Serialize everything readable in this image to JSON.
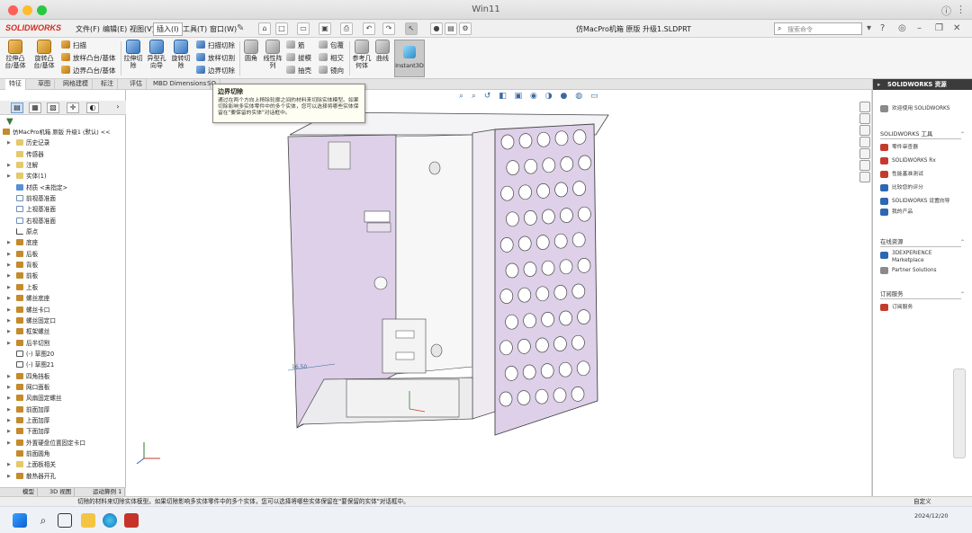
{
  "window": {
    "title": "Win11"
  },
  "menubar": {
    "logo": "SOLIDWORKS",
    "menus": [
      "文件(F)",
      "编辑(E)",
      "视图(V)",
      "插入(I)",
      "工具(T)",
      "窗口(W)"
    ],
    "active_menu_index": 3,
    "doc_title": "仿MacPro机箱 原版 升级1.SLDPRT",
    "search_placeholder": "搜索命令"
  },
  "commands": {
    "big": [
      {
        "label": "拉伸凸台/基体"
      },
      {
        "label": "旋转凸台/基体"
      },
      {
        "label": "拉伸切除"
      },
      {
        "label": "异型孔向导"
      },
      {
        "label": "旋转切除"
      },
      {
        "label": "圆角"
      },
      {
        "label": "线性阵列"
      },
      {
        "label": "参考几何体"
      },
      {
        "label": "曲线"
      },
      {
        "label": "Instant3D"
      }
    ],
    "small": {
      "sweep": "扫描",
      "loft": "放样凸台/基体",
      "boundary": "边界凸台/基体",
      "sweep_cut": "扫描切除",
      "loft_cut": "放样切割",
      "boundary_cut": "边界切除",
      "rib": "筋",
      "wrap": "包覆",
      "draft": "拔模",
      "intersect": "相交",
      "shell": "抽壳",
      "mirror": "镜向"
    }
  },
  "command_tabs": [
    "特征",
    "草图",
    "网格建模",
    "标注",
    "评估",
    "MBD Dimensions",
    "SO"
  ],
  "tooltip": {
    "title": "边界切除",
    "body": "通过在两个方向上移除轮廓之间的材料来切除实体模型。如果切除影响多实体零件中的多个实体，您可以选择将哪些实体保留在\"要保留的实体\"对话框中。"
  },
  "tree": {
    "root": "仿MacPro机箱 原版 升级1 (默认) <<",
    "items": [
      {
        "label": "历史记录",
        "arrow": true,
        "icon": "folder"
      },
      {
        "label": "传感器",
        "arrow": false,
        "icon": "folder"
      },
      {
        "label": "注解",
        "arrow": true,
        "icon": "folder"
      },
      {
        "label": "实体(1)",
        "arrow": true,
        "icon": "folder"
      },
      {
        "label": "材质 <未指定>",
        "arrow": false,
        "icon": "blue"
      },
      {
        "label": "前视基准面",
        "arrow": false,
        "icon": "plane"
      },
      {
        "label": "上视基准面",
        "arrow": false,
        "icon": "plane"
      },
      {
        "label": "右视基准面",
        "arrow": false,
        "icon": "plane"
      },
      {
        "label": "原点",
        "arrow": false,
        "icon": "origin"
      },
      {
        "label": "底座",
        "arrow": true,
        "icon": "feature"
      },
      {
        "label": "后板",
        "arrow": true,
        "icon": "feature"
      },
      {
        "label": "背板",
        "arrow": true,
        "icon": "feature"
      },
      {
        "label": "前板",
        "arrow": true,
        "icon": "feature"
      },
      {
        "label": "上板",
        "arrow": true,
        "icon": "feature"
      },
      {
        "label": "螺丝底座",
        "arrow": true,
        "icon": "feature"
      },
      {
        "label": "螺丝卡口",
        "arrow": true,
        "icon": "feature"
      },
      {
        "label": "螺丝固定口",
        "arrow": true,
        "icon": "feature"
      },
      {
        "label": "框架螺丝",
        "arrow": true,
        "icon": "feature"
      },
      {
        "label": "后半切割",
        "arrow": true,
        "icon": "feature"
      },
      {
        "label": "(-) 草图20",
        "arrow": false,
        "icon": "sketch"
      },
      {
        "label": "(-) 草图21",
        "arrow": false,
        "icon": "sketch"
      },
      {
        "label": "四角挡板",
        "arrow": true,
        "icon": "feature"
      },
      {
        "label": "网口面板",
        "arrow": true,
        "icon": "feature"
      },
      {
        "label": "风扇固定螺丝",
        "arrow": true,
        "icon": "feature"
      },
      {
        "label": "前面加厚",
        "arrow": true,
        "icon": "feature"
      },
      {
        "label": "上面加厚",
        "arrow": true,
        "icon": "feature"
      },
      {
        "label": "下面加厚",
        "arrow": true,
        "icon": "feature"
      },
      {
        "label": "外置硬盘位置固定卡口",
        "arrow": true,
        "icon": "feature"
      },
      {
        "label": "前面圆角",
        "arrow": false,
        "icon": "feature"
      },
      {
        "label": "上面板相关",
        "arrow": true,
        "icon": "folder"
      },
      {
        "label": "散热器开孔",
        "arrow": true,
        "icon": "feature"
      }
    ]
  },
  "bottom_tabs": [
    "模型",
    "3D 视图",
    "运动算例 1"
  ],
  "viewport": {
    "dimension_label": "16.50"
  },
  "resources": {
    "header": "SOLIDWORKS 资源",
    "welcome": "欢迎使用 SOLIDWORKS",
    "tools_title": "SOLIDWORKS 工具",
    "tools": [
      "零件审查器",
      "SOLIDWORKS Rx",
      "性能基准测试",
      "比较您的评分",
      "SOLIDWORKS 设置向导",
      "我的产品"
    ],
    "community_title": "在线资源",
    "community": [
      "3DEXPERIENCE Marketplace",
      "Partner Solutions"
    ],
    "subscription_title": "订阅服务",
    "subscription": [
      "订阅服务"
    ]
  },
  "statusbar": {
    "text": "切除的材料来切除实体模型。如果切除影响多实体零件中的多个实体，您可以选择将哪些实体保留在\"要保留的实体\"对话框中。",
    "right": "自定义"
  },
  "taskbar": {
    "date": "2024/12/20"
  },
  "colors": {
    "part_face": "#ddd0e8",
    "part_edge": "#444444",
    "accent": "#d52b1e"
  }
}
